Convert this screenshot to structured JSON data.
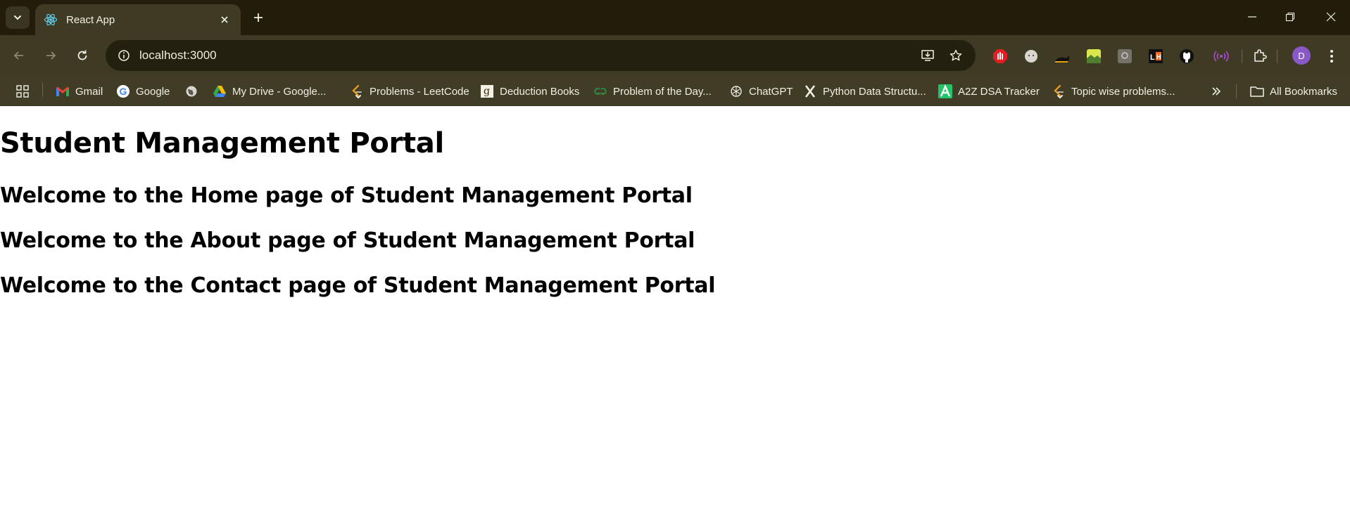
{
  "browser": {
    "tab": {
      "title": "React App",
      "favicon": "react-icon"
    },
    "address_bar": {
      "url": "localhost:3000"
    },
    "profile_initial": "D",
    "bookmarks": [
      {
        "label": "",
        "icon": "apps-grid-icon"
      },
      {
        "label": "Gmail",
        "icon": "gmail-icon"
      },
      {
        "label": "Google",
        "icon": "google-icon"
      },
      {
        "label": "",
        "icon": "globe-icon"
      },
      {
        "label": "My Drive - Google...",
        "icon": "drive-icon"
      },
      {
        "label": "Problems - LeetCode",
        "icon": "leetcode-icon"
      },
      {
        "label": "Deduction Books",
        "icon": "goodreads-icon"
      },
      {
        "label": "Problem of the Day...",
        "icon": "gfg-icon"
      },
      {
        "label": "ChatGPT",
        "icon": "chatgpt-icon"
      },
      {
        "label": "Python Data Structu...",
        "icon": "x-icon"
      },
      {
        "label": "A2Z DSA Tracker",
        "icon": "a2z-icon"
      },
      {
        "label": "Topic wise problems...",
        "icon": "leetcode-icon"
      }
    ],
    "all_bookmarks_label": "All Bookmarks",
    "colors": {
      "frame": "#221d0b",
      "toolbar": "#3e3a24",
      "omnibox": "#24200f"
    }
  },
  "page": {
    "title": "Student Management Portal",
    "sections": [
      "Welcome to the Home page of Student Management Portal",
      "Welcome to the About page of Student Management Portal",
      "Welcome to the Contact page of Student Management Portal"
    ]
  }
}
